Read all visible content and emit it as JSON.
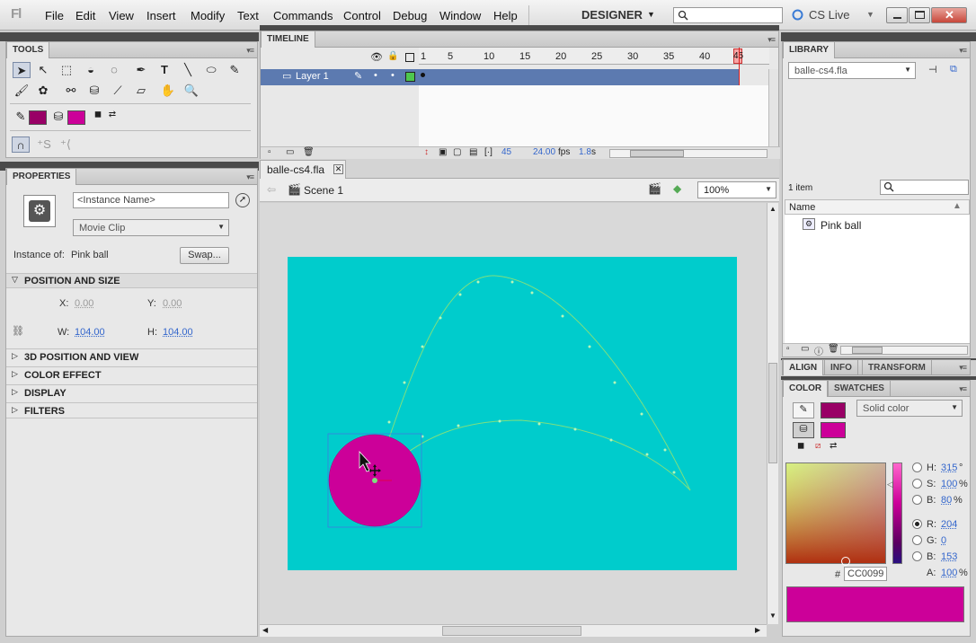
{
  "app": {
    "logo": "Fl",
    "workspace": "DESIGNER",
    "cs_live": "CS Live"
  },
  "menu": [
    "File",
    "Edit",
    "View",
    "Insert",
    "Modify",
    "Text",
    "Commands",
    "Control",
    "Debug",
    "Window",
    "Help"
  ],
  "tools_panel": {
    "title": "TOOLS"
  },
  "timeline": {
    "title": "TIMELINE",
    "layer": "Layer 1",
    "frame_numbers": [
      "1",
      "5",
      "10",
      "15",
      "20",
      "25",
      "30",
      "35",
      "40",
      "45"
    ],
    "current_frame": "45",
    "status_frame": "45",
    "fps": "24.00",
    "fps_unit": "fps",
    "time": "1.8",
    "time_unit": "s"
  },
  "document": {
    "tab": "balle-cs4.fla",
    "scene": "Scene 1",
    "zoom": "100%"
  },
  "stage": {
    "background": "#00cccc",
    "ball_color": "#cc0099"
  },
  "properties": {
    "title": "PROPERTIES",
    "instance_name_placeholder": "<Instance Name>",
    "symbol_type": "Movie Clip",
    "instance_of_label": "Instance of:",
    "instance_of_value": "Pink ball",
    "swap": "Swap...",
    "position_and_size": "POSITION AND SIZE",
    "x_label": "X:",
    "x": "0.00",
    "y_label": "Y:",
    "y": "0.00",
    "w_label": "W:",
    "w": "104.00",
    "h_label": "H:",
    "h": "104.00",
    "sections": [
      "3D POSITION AND VIEW",
      "COLOR EFFECT",
      "DISPLAY",
      "FILTERS"
    ]
  },
  "library": {
    "title": "LIBRARY",
    "file": "balle-cs4.fla",
    "count": "1 item",
    "column_name": "Name",
    "items": [
      "Pink ball"
    ]
  },
  "align_tabs": [
    "ALIGN",
    "INFO",
    "TRANSFORM"
  ],
  "color_panel": {
    "tabs": [
      "COLOR",
      "SWATCHES"
    ],
    "fill_type": "Solid color",
    "stroke_color": "#990066",
    "fill_color": "#cc0099",
    "h_label": "H:",
    "h": "315",
    "h_unit": "°",
    "s_label": "S:",
    "s": "100",
    "s_unit": "%",
    "b_label": "B:",
    "b": "80",
    "b_unit": "%",
    "r_label": "R:",
    "r": "204",
    "g_label": "G:",
    "g": "0",
    "bl_label": "B:",
    "bl": "153",
    "a_label": "A:",
    "a": "100",
    "a_unit": "%",
    "hex_label": "#",
    "hex": "CC0099"
  }
}
